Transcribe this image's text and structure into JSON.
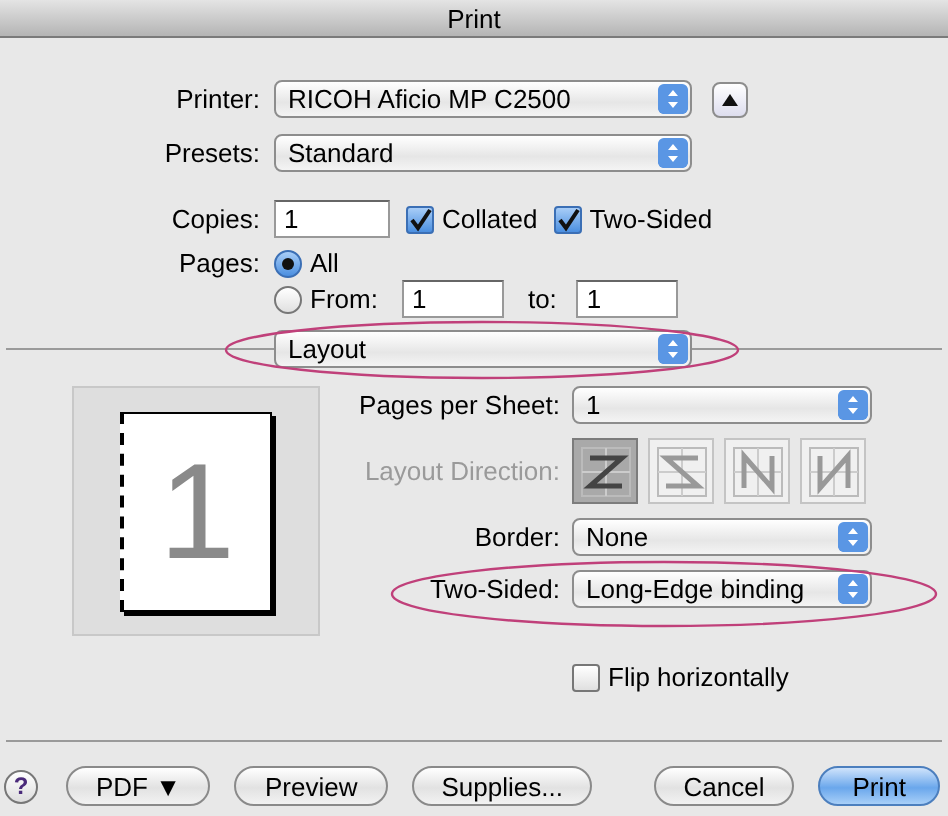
{
  "window": {
    "title": "Print"
  },
  "printer": {
    "label": "Printer:",
    "value": "RICOH Aficio MP C2500"
  },
  "presets": {
    "label": "Presets:",
    "value": "Standard"
  },
  "copies": {
    "label": "Copies:",
    "value": "1"
  },
  "options": [
    {
      "label": "Collated",
      "checked": true
    },
    {
      "label": "Two-Sided",
      "checked": true
    }
  ],
  "pages": {
    "label": "Pages:",
    "choices": [
      {
        "label": "All",
        "selected": true
      },
      {
        "label": "From:",
        "selected": false
      }
    ],
    "from": "1",
    "to_label": "to:",
    "to": "1"
  },
  "panel": {
    "value": "Layout"
  },
  "preview": {
    "page_number": "1"
  },
  "layout_rows": [
    {
      "kind": "popup",
      "label": "Pages per Sheet:",
      "value": "1"
    },
    {
      "kind": "direction",
      "label": "Layout Direction:",
      "disabled": true,
      "options": [
        {
          "selected": true
        },
        {
          "selected": false
        },
        {
          "selected": false
        },
        {
          "selected": false
        }
      ]
    },
    {
      "kind": "popup",
      "label": "Border:",
      "value": "None"
    },
    {
      "kind": "popup",
      "label": "Two-Sided:",
      "value": "Long-Edge binding"
    }
  ],
  "flip": {
    "label": "Flip horizontally",
    "checked": false
  },
  "help": "?",
  "left_buttons": [
    "PDF ▼",
    "Preview",
    "Supplies..."
  ],
  "right_buttons": [
    {
      "label": "Cancel",
      "default": false
    },
    {
      "label": "Print",
      "default": true
    }
  ]
}
